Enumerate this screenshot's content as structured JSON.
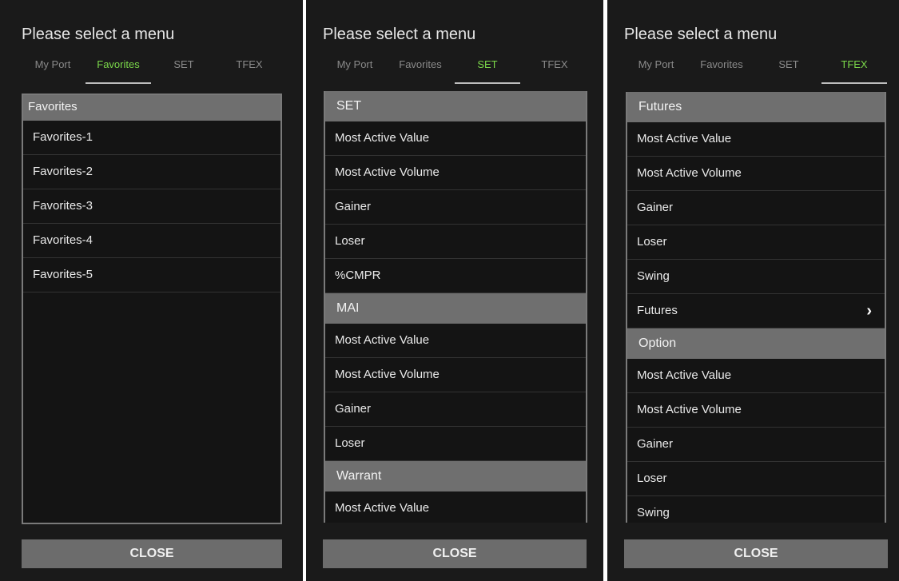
{
  "panels": [
    {
      "title": "Please select a menu",
      "tabs": [
        "My Port",
        "Favorites",
        "SET",
        "TFEX"
      ],
      "active_tab": 1,
      "sections": [
        {
          "header": "Favorites",
          "items": [
            "Favorites-1",
            "Favorites-2",
            "Favorites-3",
            "Favorites-4",
            "Favorites-5"
          ]
        }
      ],
      "close_label": "CLOSE"
    },
    {
      "title": "Please select a menu",
      "tabs": [
        "My Port",
        "Favorites",
        "SET",
        "TFEX"
      ],
      "active_tab": 2,
      "sections": [
        {
          "header": "SET",
          "items": [
            "Most Active Value",
            "Most Active Volume",
            "Gainer",
            "Loser",
            "%CMPR"
          ]
        },
        {
          "header": "MAI",
          "items": [
            "Most Active Value",
            "Most Active Volume",
            "Gainer",
            "Loser"
          ]
        },
        {
          "header": "Warrant",
          "items": [
            "Most Active Value"
          ]
        }
      ],
      "close_label": "CLOSE"
    },
    {
      "title": "Please select a menu",
      "tabs": [
        "My Port",
        "Favorites",
        "SET",
        "TFEX"
      ],
      "active_tab": 3,
      "sections": [
        {
          "header": "Futures",
          "items": [
            "Most Active Value",
            "Most Active Volume",
            "Gainer",
            "Loser",
            "Swing",
            "Futures"
          ],
          "submenu_item": "Futures"
        },
        {
          "header": "Option",
          "items": [
            "Most Active Value",
            "Most Active Volume",
            "Gainer",
            "Loser",
            "Swing"
          ]
        }
      ],
      "close_label": "CLOSE"
    }
  ],
  "icons": {
    "submenu": "chevron-right-icon"
  },
  "colors": {
    "active_tab": "#7bd84a",
    "panel_bg": "#1a1a1a",
    "section_header_bg": "#6f6f6f",
    "close_button_bg": "#6c6c6c"
  }
}
